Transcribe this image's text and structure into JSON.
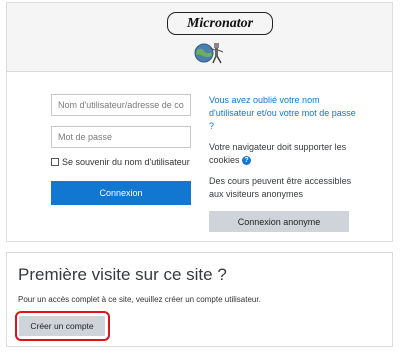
{
  "header": {
    "logo_text": "Micronator",
    "logo_icon": "globe-robot-icon"
  },
  "login": {
    "username_placeholder": "Nom d'utilisateur/adresse de courriel",
    "password_placeholder": "Mot de passe",
    "remember_label": "Se souvenir du nom d'utilisateur",
    "login_button": "Connexion"
  },
  "info": {
    "forgot_link": "Vous avez oublié votre nom d'utilisateur et/ou votre mot de passe ?",
    "cookies_text": "Votre navigateur doit supporter les cookies",
    "help_icon": "?",
    "guest_text": "Des cours peuvent être accessibles aux visiteurs anonymes",
    "guest_button": "Connexion anonyme"
  },
  "signup": {
    "title": "Première visite sur ce site ?",
    "description": "Pour un accès complet à ce site, veuillez créer un compte utilisateur.",
    "create_button": "Créer un compte",
    "highlight_color": "#e0131a"
  },
  "colors": {
    "primary": "#1177d1",
    "secondary_button": "#ced4da",
    "header_bg": "#f5f5f5"
  }
}
